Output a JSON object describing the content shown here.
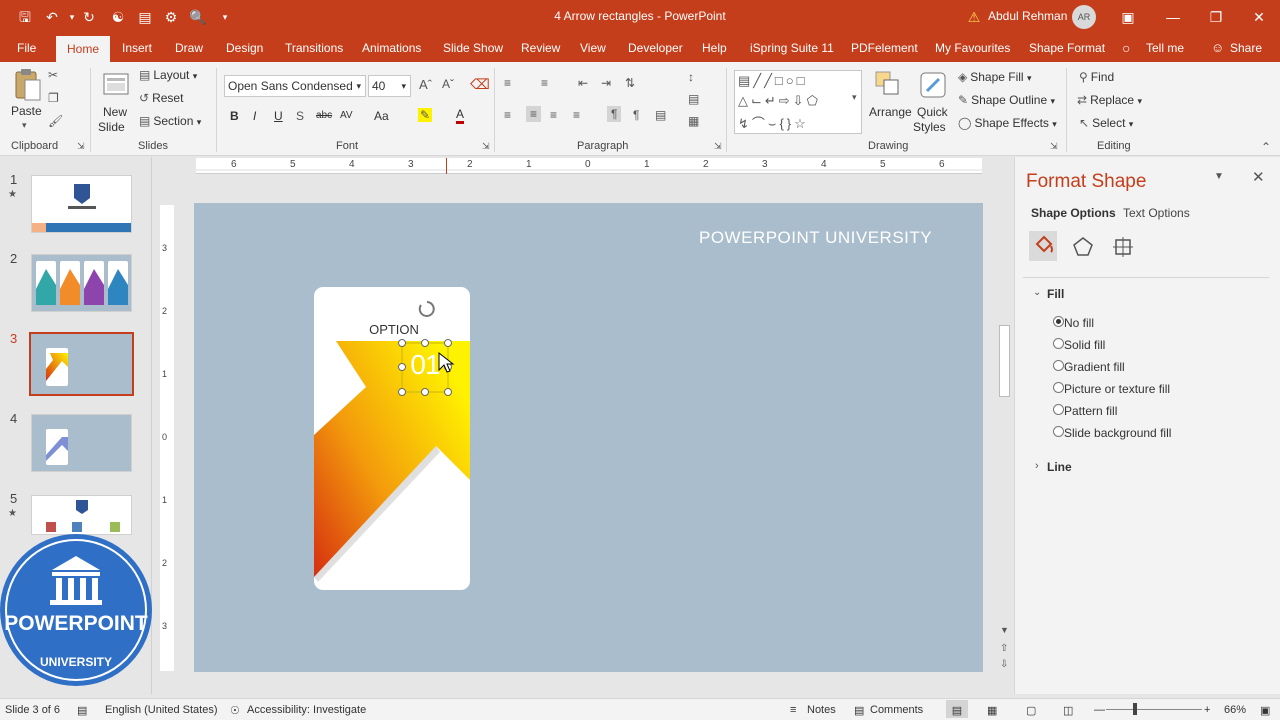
{
  "window": {
    "title": "4 Arrow rectangles - PowerPoint",
    "user": "Abdul Rehman",
    "avatar_initials": "AR"
  },
  "quick_access": [
    "save-icon",
    "undo-icon",
    "redo-icon",
    "repeat-icon",
    "touch-mode-icon",
    "present-icon",
    "preview-icon",
    "customize-icon"
  ],
  "tabs": [
    "File",
    "Home",
    "Insert",
    "Draw",
    "Design",
    "Transitions",
    "Animations",
    "Slide Show",
    "Review",
    "View",
    "Developer",
    "Help",
    "iSpring Suite 11",
    "PDFelement",
    "My Favourites",
    "Shape Format",
    "Tell me",
    "Share"
  ],
  "ribbon": {
    "clipboard": {
      "label": "Clipboard",
      "paste": "Paste"
    },
    "slides": {
      "label": "Slides",
      "new_slide_1": "New",
      "new_slide_2": "Slide",
      "layout": "Layout",
      "reset": "Reset",
      "section": "Section"
    },
    "font": {
      "label": "Font",
      "family": "Open Sans Condensed",
      "size": "40",
      "bold": "B",
      "italic": "I",
      "underline": "U",
      "strike": "abc",
      "spacing": "AV",
      "case": "Aa",
      "color": "A"
    },
    "paragraph": {
      "label": "Paragraph"
    },
    "drawing": {
      "label": "Drawing",
      "arrange": "Arrange",
      "quick_styles_1": "Quick",
      "quick_styles_2": "Styles",
      "shape_fill": "Shape Fill",
      "shape_outline": "Shape Outline",
      "shape_effects": "Shape Effects"
    },
    "editing": {
      "label": "Editing",
      "find": "Find",
      "replace": "Replace",
      "select": "Select"
    }
  },
  "ruler_h": [
    "6",
    "5",
    "4",
    "3",
    "2",
    "1",
    "0",
    "1",
    "2",
    "3",
    "4",
    "5",
    "6"
  ],
  "ruler_v": [
    "3",
    "2",
    "1",
    "0",
    "1",
    "2",
    "3"
  ],
  "slides": [
    {
      "num": "1",
      "star": "★"
    },
    {
      "num": "2",
      "star": ""
    },
    {
      "num": "3",
      "star": ""
    },
    {
      "num": "4",
      "star": ""
    },
    {
      "num": "5",
      "star": "★"
    }
  ],
  "logo": {
    "text": "POWERPOINT",
    "sub": "UNIVERSITY"
  },
  "slide": {
    "title": "POWERPOINT UNIVERSITY",
    "option_label": "OPTION",
    "number": "01"
  },
  "format_pane": {
    "title": "Format Shape",
    "tab_shape": "Shape Options",
    "tab_text": "Text Options",
    "fill_header": "Fill",
    "fill_options": [
      "No fill",
      "Solid fill",
      "Gradient fill",
      "Picture or texture fill",
      "Pattern fill",
      "Slide background fill"
    ],
    "selected_fill": 0,
    "line_header": "Line"
  },
  "status": {
    "slide": "Slide 3 of 6",
    "language": "English (United States)",
    "accessibility": "Accessibility: Investigate",
    "notes": "Notes",
    "comments": "Comments",
    "zoom": "66%"
  },
  "colors": {
    "accent": "#c43e1c",
    "slide_bg": "#a9bdcc",
    "arrow_start": "#d62f10",
    "arrow_end": "#fff200"
  }
}
